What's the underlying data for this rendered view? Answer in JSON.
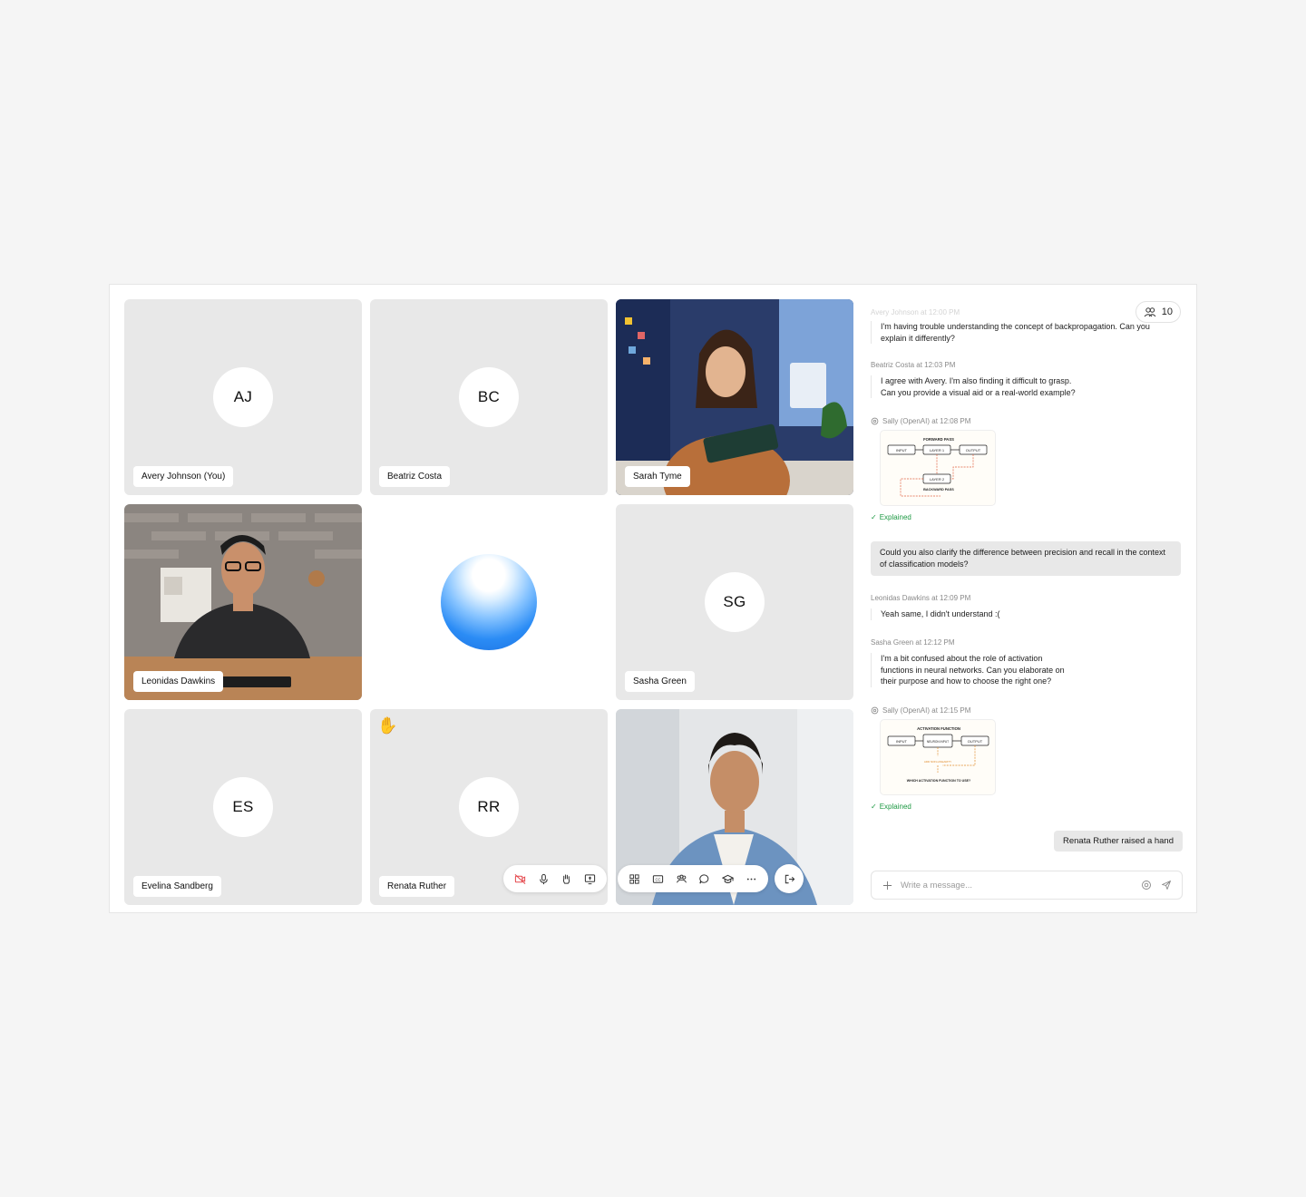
{
  "participants": {
    "avery": {
      "initials": "AJ",
      "name": "Avery Johnson (You)"
    },
    "beatriz": {
      "initials": "BC",
      "name": "Beatriz Costa"
    },
    "sarah": {
      "name": "Sarah Tyme"
    },
    "leonidas": {
      "name": "Leonidas Dawkins"
    },
    "sasha": {
      "initials": "SG",
      "name": "Sasha Green"
    },
    "evelina": {
      "initials": "ES",
      "name": "Evelina Sandberg"
    },
    "renata": {
      "initials": "RR",
      "name": "Renata Ruther",
      "hand_icon": "raised-hand-icon"
    }
  },
  "toolbar_left": {
    "icons": [
      "camera-off-icon",
      "microphone-icon",
      "raise-hand-icon",
      "share-screen-icon"
    ],
    "accent_color": "#e5484d"
  },
  "toolbar_right": {
    "icons": [
      "grid-view-icon",
      "captions-icon",
      "participants-icon",
      "chat-icon",
      "learning-icon",
      "more-icon"
    ],
    "leave_icon": "leave-icon"
  },
  "chat": {
    "participant_count": "10",
    "messages": [
      {
        "author": "Avery Johnson at 12:00 PM",
        "text": "I'm having trouble understanding the concept of backpropagation. Can you explain it differently?"
      },
      {
        "author": "Beatriz Costa at 12:03 PM",
        "text": "I agree with Avery. I'm also finding it difficult to grasp. Can you provide a visual aid or a real-world example?"
      },
      {
        "author": "Sally (OpenAI) at 12:08 PM",
        "status": "Explained",
        "diagram": {
          "title": "FORWARD PASS",
          "n1": "INPUT",
          "n2": "LAYER 1",
          "n3": "OUTPUT",
          "n4": "LAYER 2",
          "caption": "BACKWARD PASS"
        }
      },
      {
        "own_text": "Could you also clarify the difference between precision and recall in the context of classification models?"
      },
      {
        "author": "Leonidas Dawkins at 12:09 PM",
        "text": "Yeah same, I didn't understand :("
      },
      {
        "author": "Sasha Green at 12:12 PM",
        "text": "I'm a bit confused about the role of activation functions in neural networks. Can you elaborate on their purpose and how to choose the right one?"
      },
      {
        "author": "Sally (OpenAI) at 12:15 PM",
        "status": "Explained",
        "diagram": {
          "title": "ACTIVATION FUNCTION",
          "n1": "INPUT",
          "n2": "NEURON INPUT",
          "n3": "OUTPUT",
          "n4": "ADD NON-LINEARITY",
          "caption": "WHICH ACTIVATION FUNCTION TO USE?"
        }
      }
    ],
    "system_event": "Renata Ruther raised a hand",
    "composer_placeholder": "Write a message..."
  }
}
